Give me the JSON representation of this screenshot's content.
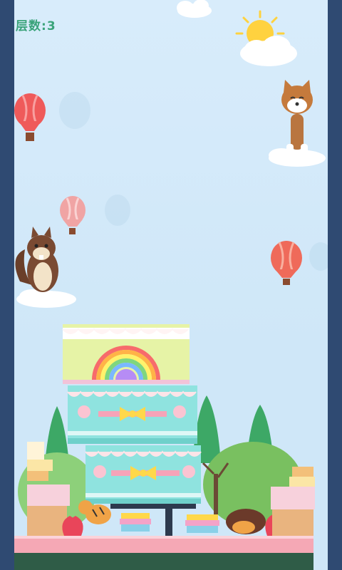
{
  "hud": {
    "floor_label": "层数",
    "separator": ":",
    "floor_value": "3"
  },
  "colors": {
    "side_rail": "#2f4a72",
    "sky": "#d8ecfb",
    "score_text": "#3aa37a",
    "balloon_red": "#ef5a5a",
    "cake_teal": "#8fe3df",
    "cake_lime": "#e6f3a6"
  },
  "sprites": {
    "sun": "sun-icon",
    "balloons": [
      "hot-air-balloon-icon",
      "hot-air-balloon-icon",
      "hot-air-balloon-icon"
    ],
    "animals": [
      "squirrel-icon",
      "shiba-dog-icon",
      "tiger-icon"
    ],
    "cake": "stacked-cake-icon",
    "trees": "tree-icon"
  },
  "tower": {
    "stacked_layers": 3
  }
}
